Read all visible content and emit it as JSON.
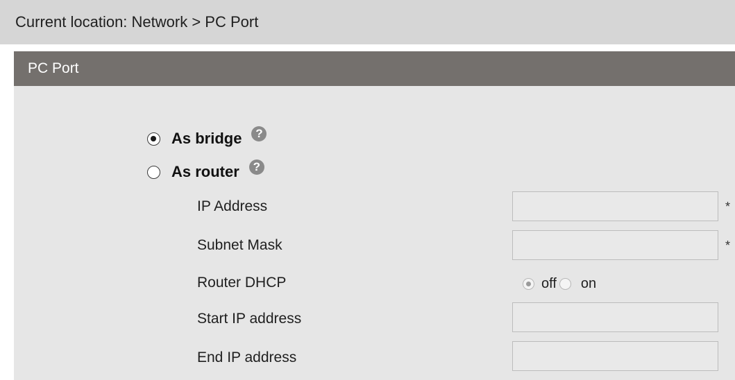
{
  "breadcrumb": "Current location: Network > PC Port",
  "panel": {
    "title": "PC Port",
    "modes": [
      {
        "label": "As bridge",
        "checked": true,
        "help_icon": "question-circle-icon"
      },
      {
        "label": "As router",
        "checked": false,
        "help_icon": "question-circle-icon"
      }
    ],
    "help_glyph": "?",
    "fields": {
      "ip_address": {
        "label": "IP Address",
        "value": "",
        "required_mark": "*"
      },
      "subnet_mask": {
        "label": "Subnet Mask",
        "value": "",
        "required_mark": "*"
      },
      "router_dhcp": {
        "label": "Router DHCP",
        "options": [
          "off",
          "on"
        ],
        "selected": "off"
      },
      "start_ip": {
        "label": "Start IP address",
        "value": ""
      },
      "end_ip": {
        "label": "End IP address",
        "value": ""
      }
    }
  },
  "colors": {
    "breadcrumb_bg": "#d6d6d6",
    "panel_header_bg": "#74706d",
    "panel_bg": "#e6e6e6"
  }
}
